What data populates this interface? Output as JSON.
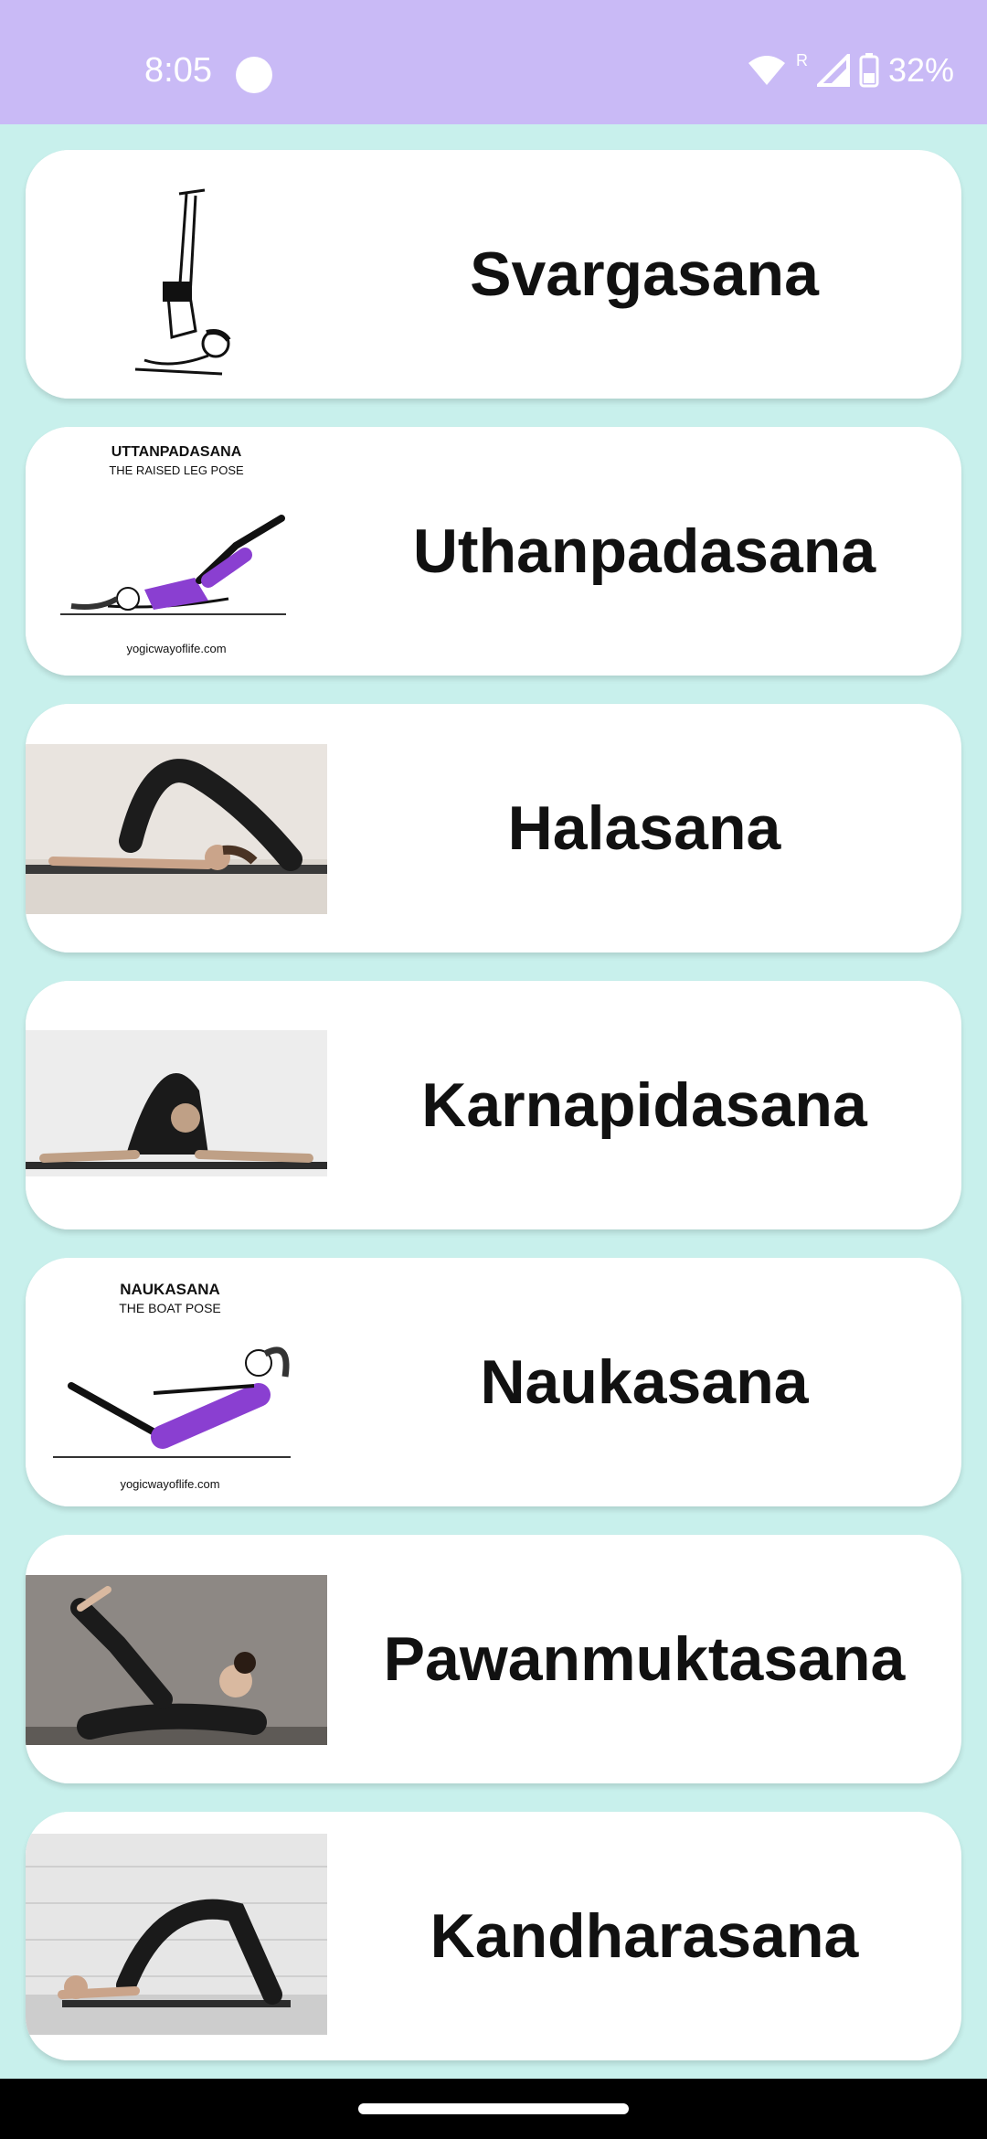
{
  "status_bar": {
    "time": "8:05",
    "roaming": "R",
    "battery": "32%"
  },
  "poses": [
    {
      "name": "Svargasana"
    },
    {
      "name": "Uthanpadasana",
      "caption_title": "UTTANPADASANA",
      "caption_subtitle": "THE RAISED LEG POSE",
      "caption_site": "yogicwayoflife.com"
    },
    {
      "name": "Halasana"
    },
    {
      "name": "Karnapidasana"
    },
    {
      "name": "Naukasana",
      "caption_title": "NAUKASANA",
      "caption_subtitle": "THE BOAT POSE",
      "caption_site": "yogicwayoflife.com"
    },
    {
      "name": "Pawanmuktasana"
    },
    {
      "name": "Kandharasana"
    }
  ],
  "colors": {
    "status_bar_bg": "#c9baf6",
    "list_bg": "#c8f0ec",
    "card_bg": "#ffffff",
    "purple_garment": "#8a3fd1"
  }
}
